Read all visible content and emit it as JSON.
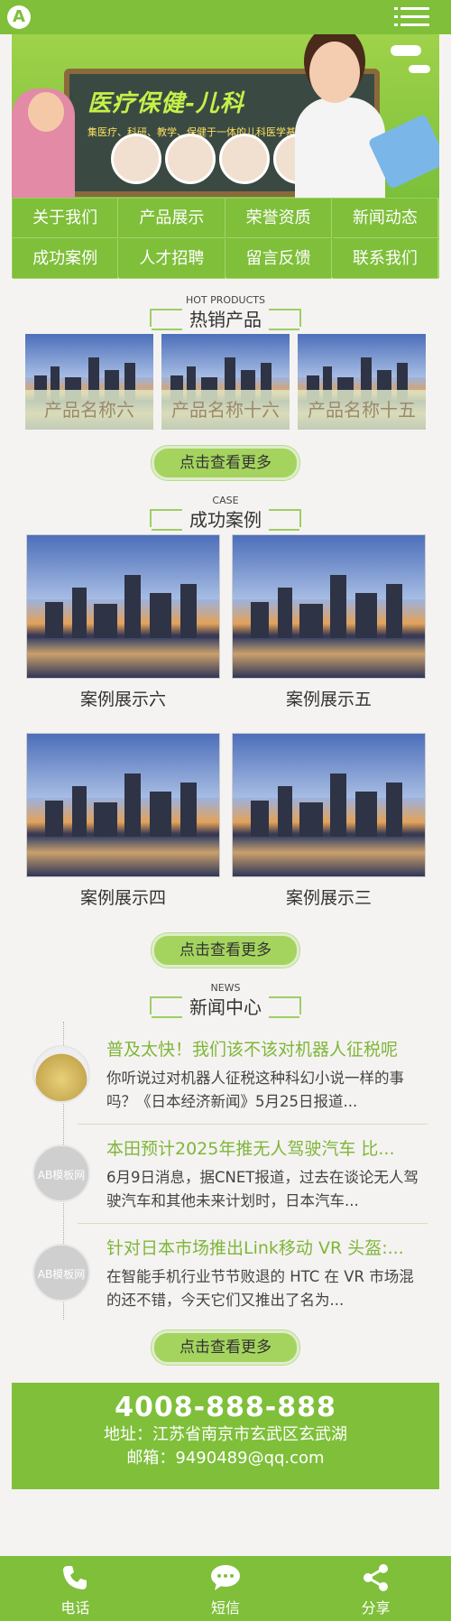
{
  "header": {
    "logo_letter": "A"
  },
  "banner": {
    "title": "医疗保健-儿科",
    "subtitle": "集医疗、科研、教学、保健于一体的儿科医学基地"
  },
  "nav": [
    {
      "label": "关于我们"
    },
    {
      "label": "产品展示"
    },
    {
      "label": "荣誉资质"
    },
    {
      "label": "新闻动态"
    },
    {
      "label": "成功案例"
    },
    {
      "label": "人才招聘"
    },
    {
      "label": "留言反馈"
    },
    {
      "label": "联系我们"
    }
  ],
  "hot": {
    "title_en": "HOT PRODUCTS",
    "title_cn": "热销产品",
    "items": [
      {
        "label": "产品名称六"
      },
      {
        "label": "产品名称十六"
      },
      {
        "label": "产品名称十五"
      }
    ],
    "more": "点击查看更多"
  },
  "cases": {
    "title_en": "CASE",
    "title_cn": "成功案例",
    "items": [
      {
        "label": "案例展示六"
      },
      {
        "label": "案例展示五"
      },
      {
        "label": "案例展示四"
      },
      {
        "label": "案例展示三"
      }
    ],
    "more": "点击查看更多"
  },
  "news": {
    "title_en": "NEWS",
    "title_cn": "新闻中心",
    "items": [
      {
        "title": "普及太快！我们该不该对机器人征税呢",
        "desc": "你听说过对机器人征税这种科幻小说一样的事吗？《日本经济新闻》5月25日报道...",
        "thumb": ""
      },
      {
        "title": "本田预计2025年推无人驾驶汽车 比...",
        "desc": "6月9日消息，据CNET报道，过去在谈论无人驾驶汽车和其他未来计划时，日本汽车...",
        "thumb": "AB模板网"
      },
      {
        "title": "针对日本市场推出Link移动 VR 头盔:...",
        "desc": "在智能手机行业节节败退的 HTC 在 VR 市场混的还不错，今天它们又推出了名为...",
        "thumb": "AB模板网"
      }
    ],
    "more": "点击查看更多"
  },
  "contact": {
    "tel": "4008-888-888",
    "address": "地址：江苏省南京市玄武区玄武湖",
    "email": "邮箱：9490489@qq.com"
  },
  "footer": {
    "call": "电话",
    "sms": "短信",
    "share": "分享"
  },
  "colors": {
    "brand_green": "#7fbf3a",
    "title_green": "#7fb63a"
  }
}
